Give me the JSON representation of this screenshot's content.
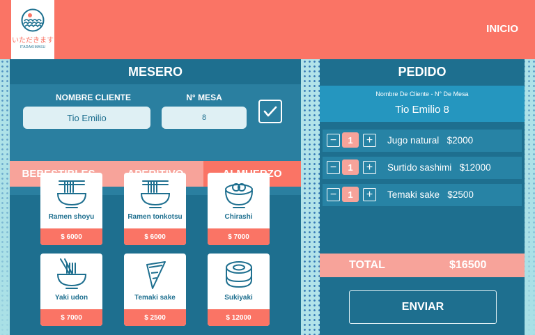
{
  "header": {
    "logo_jp": "いただきます",
    "logo_en": "ITADAKIMASU",
    "nav_inicio": "INICIO"
  },
  "mesero": {
    "title": "MESERO",
    "cliente_label": "NOMBRE CLIENTE",
    "cliente_value": "Tio Emilio",
    "mesa_label": "N° MESA",
    "mesa_value": "8",
    "confirm_icon": "checkmark-icon",
    "tabs": [
      {
        "label": "BEBESTIBLES",
        "active": false
      },
      {
        "label": "APERITIVO",
        "active": false
      },
      {
        "label": "ALMUERZO",
        "active": true
      }
    ],
    "menu": [
      {
        "name": "Ramen shoyu",
        "price": "$ 6000",
        "icon": "ramen-bowl-icon"
      },
      {
        "name": "Ramen tonkotsu",
        "price": "$ 6000",
        "icon": "ramen-bowl-icon"
      },
      {
        "name": "Chirashi",
        "price": "$ 7000",
        "icon": "chirashi-bowl-icon"
      },
      {
        "name": "Yaki udon",
        "price": "$ 7000",
        "icon": "udon-bowl-icon"
      },
      {
        "name": "Temaki sake",
        "price": "$ 2500",
        "icon": "temaki-icon"
      },
      {
        "name": "Sukiyaki",
        "price": "$ 12000",
        "icon": "sukiyaki-pot-icon"
      }
    ]
  },
  "pedido": {
    "title": "PEDIDO",
    "subtitle": "Nombre De Cliente - N° De Mesa",
    "client_display": "Tio Emilio 8",
    "items": [
      {
        "qty": "1",
        "name": "Jugo natural",
        "price": "$2000"
      },
      {
        "qty": "1",
        "name": "Surtido sashimi",
        "price": "$12000"
      },
      {
        "qty": "1",
        "name": "Temaki sake",
        "price": "$2500"
      }
    ],
    "total_label": "TOTAL",
    "total_value": "$16500",
    "send_label": "ENVIAR"
  },
  "colors": {
    "coral": "#fa7465",
    "salmon_light": "#f7a39a",
    "teal_dark": "#1e6f8f",
    "teal_mid": "#2a7fa0",
    "teal_bright": "#2596bf",
    "light_input": "#dff0f4"
  }
}
